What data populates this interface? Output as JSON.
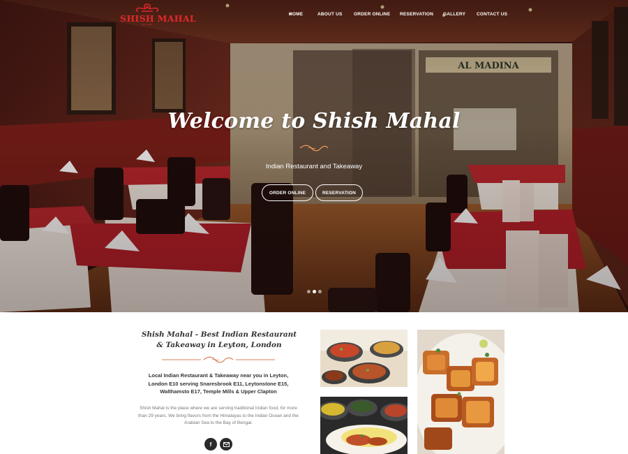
{
  "brand": {
    "logo_text": "SHISH MAHAL",
    "logo_sub": "EST. 1988",
    "accent_color": "#e2272b",
    "dark_color": "#2a2a2a"
  },
  "nav": {
    "items": [
      {
        "label": "HOME"
      },
      {
        "label": "ABOUT US"
      },
      {
        "label": "ORDER ONLINE"
      },
      {
        "label": "RESERVATION"
      },
      {
        "label": "GALLERY"
      },
      {
        "label": "CONTACT US"
      }
    ]
  },
  "hero": {
    "title": "Welcome to Shish Mahal",
    "subtitle": "Indian Restaurant and Takeaway",
    "order_button": "ORDER ONLINE",
    "reservation_button": "RESERVATION",
    "slides_total": 3,
    "active_slide": 2
  },
  "intro": {
    "heading": "Shish Mahal - Best Indian Restaurant & Takeaway in Leyton, London",
    "lead": "Local Indian Restaurant & Takeaway near you in Leyton, London E10 serving Snaresbrook E11, Leytonstone E15, Walthamsto E17, Temple Mills & Upper Clapton",
    "body": "Shish Mahal is the place where we are serving traditional Indian food, for more than 29 years. We bring flavors from the Himalayas to the Indian Ocean and the Arabian Sea to the Bay of Bengal."
  },
  "social": {
    "facebook_icon": "facebook-icon",
    "email_icon": "email-icon"
  }
}
